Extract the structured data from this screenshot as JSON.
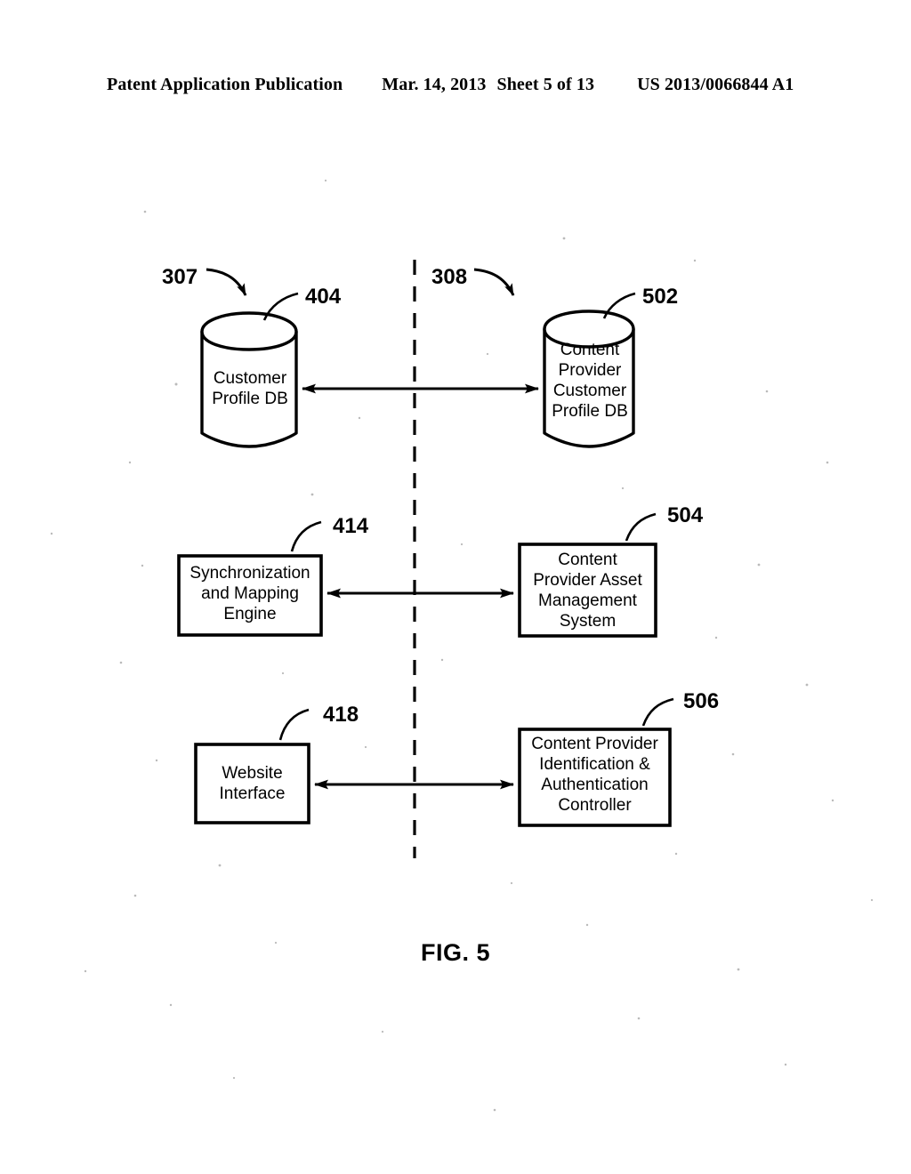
{
  "header": {
    "publication": "Patent Application Publication",
    "date": "Mar. 14, 2013",
    "sheet": "Sheet 5 of 13",
    "patent_number": "US 2013/0066844 A1"
  },
  "figure": {
    "caption": "FIG. 5",
    "divider": "vertical-dashed-boundary",
    "regions": [
      {
        "ref": "307",
        "side": "left"
      },
      {
        "ref": "308",
        "side": "right"
      }
    ],
    "nodes": [
      {
        "id": "customer-profile-db",
        "ref": "404",
        "shape": "cylinder",
        "side": "left",
        "label": "Customer\nProfile DB"
      },
      {
        "id": "content-provider-customer-profile-db",
        "ref": "502",
        "shape": "cylinder",
        "side": "right",
        "label": "Content\nProvider\nCustomer\nProfile DB"
      },
      {
        "id": "synchronization-and-mapping-engine",
        "ref": "414",
        "shape": "rectangle",
        "side": "left",
        "label": "Synchronization\nand Mapping\nEngine"
      },
      {
        "id": "content-provider-asset-management-system",
        "ref": "504",
        "shape": "rectangle",
        "side": "right",
        "label": "Content\nProvider Asset\nManagement\nSystem"
      },
      {
        "id": "website-interface",
        "ref": "418",
        "shape": "rectangle",
        "side": "left",
        "label": "Website\nInterface"
      },
      {
        "id": "content-provider-identification-authentication-controller",
        "ref": "506",
        "shape": "rectangle",
        "side": "right",
        "label": "Content Provider\nIdentification &\nAuthentication\nController"
      }
    ],
    "connections": [
      {
        "id": "conn-db",
        "from": "customer-profile-db",
        "to": "content-provider-customer-profile-db",
        "style": "double-arrow"
      },
      {
        "id": "conn-engine",
        "from": "synchronization-and-mapping-engine",
        "to": "content-provider-asset-management-system",
        "style": "double-arrow"
      },
      {
        "id": "conn-website",
        "from": "website-interface",
        "to": "content-provider-identification-authentication-controller",
        "style": "double-arrow"
      }
    ]
  },
  "colors": {
    "ink": "#000000",
    "paper": "#ffffff"
  }
}
